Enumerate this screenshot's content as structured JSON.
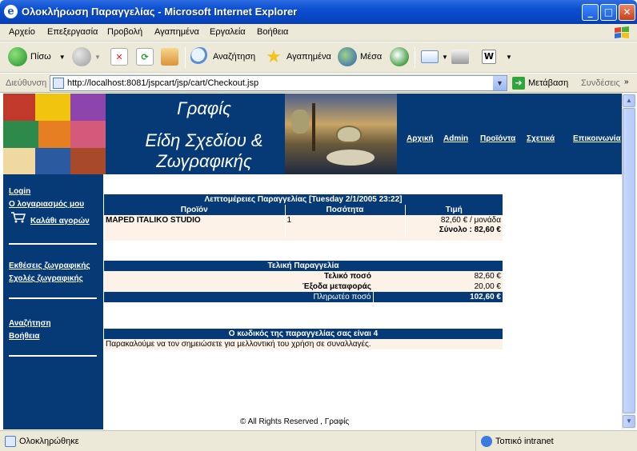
{
  "window": {
    "title": "Ολοκλήρωση Παραγγελίας - Microsoft Internet Explorer"
  },
  "menu": [
    "Αρχείο",
    "Επεξεργασία",
    "Προβολή",
    "Αγαπημένα",
    "Εργαλεία",
    "Βοήθεια"
  ],
  "toolbar": {
    "back": "Πίσω",
    "search": "Αναζήτηση",
    "favorites": "Αγαπημένα",
    "media": "Μέσα"
  },
  "address": {
    "label": "Διεύθυνση",
    "url": "http://localhost:8081/jspcart/jsp/cart/Checkout.jsp",
    "go": "Μετάβαση",
    "links": "Συνδέσεις"
  },
  "site": {
    "title_line1": "Γραφίς",
    "title_line2": "Είδη Σχεδίου &",
    "title_line3": "Ζωγραφικής",
    "nav": [
      "Αρχική",
      "Admin",
      "Προϊόντα",
      "Σχετικά",
      "Επικοινωνία"
    ]
  },
  "sidebar": {
    "login": "Login",
    "account": "Ο λογαριασμός μου",
    "cart": "Καλάθι αγορών",
    "exhibitions": "Εκθέσεις ζωγραφικής",
    "schools": "Σχολές ζωγραφικής",
    "search": "Αναζήτηση",
    "help": "Βοήθεια"
  },
  "order_details": {
    "heading": "Λεπτομέρειες Παραγγελίας [Tuesday 2/1/2005 23:22]",
    "columns": [
      "Προϊόν",
      "Ποσότητα",
      "Τιμή"
    ],
    "rows": [
      {
        "product": "MAPED ITALIKO STUDIO",
        "quantity": "1",
        "price": "82,60 € / μονάδα"
      }
    ],
    "total": "Σύνολο : 82,60 €"
  },
  "final_order": {
    "heading": "Τελική Παραγγελία",
    "lines": [
      {
        "label": "Τελικό ποσό",
        "value": "82,60 €"
      },
      {
        "label": "Έξοδα μεταφοράς",
        "value": "20,00 €"
      }
    ],
    "payable_label": "Πληρωτέο ποσό",
    "payable_value": "102,60 €"
  },
  "order_code": {
    "heading": "Ο κωδικός της παραγγελίας σας είναι 4",
    "note": "Παρακαλούμε να τον σημειώσετε για μελλοντική του χρήση σε συναλλαγές."
  },
  "footer": "© All Rights Reserved , Γραφίς",
  "status": {
    "text": "Ολοκληρώθηκε",
    "zone": "Τοπικό intranet"
  },
  "colors": {
    "brand_blue": "#063a77",
    "cream": "#fcf2e8",
    "xp_blue": "#0a4fd1"
  }
}
